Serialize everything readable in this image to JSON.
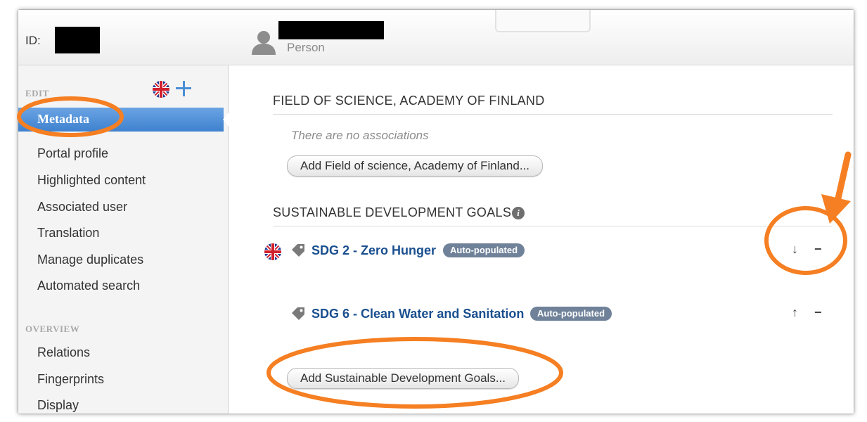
{
  "header": {
    "id_label": "ID:",
    "entity_type": "Person"
  },
  "sidebar": {
    "edit_heading": "EDIT",
    "edit_items": [
      {
        "label": "Metadata",
        "active": true
      },
      {
        "label": "Portal profile"
      },
      {
        "label": "Highlighted content"
      },
      {
        "label": "Associated user"
      },
      {
        "label": "Translation"
      },
      {
        "label": "Manage duplicates"
      },
      {
        "label": "Automated search"
      }
    ],
    "overview_heading": "OVERVIEW",
    "overview_items": [
      {
        "label": "Relations"
      },
      {
        "label": "Fingerprints"
      },
      {
        "label": "Display"
      }
    ]
  },
  "main": {
    "field_of_science": {
      "title": "FIELD OF SCIENCE, ACADEMY OF FINLAND",
      "empty_text": "There are no associations",
      "add_button": "Add Field of science, Academy of Finland..."
    },
    "sdg": {
      "title": "SUSTAINABLE DEVELOPMENT GOALS",
      "info_glyph": "i",
      "items": [
        {
          "label": "SDG 2 - Zero Hunger",
          "badge": "Auto-populated",
          "move": "↓",
          "remove": "−",
          "has_flag": true
        },
        {
          "label": "SDG 6 - Clean Water and Sanitation",
          "badge": "Auto-populated",
          "move": "↑",
          "remove": "−",
          "has_flag": false
        }
      ],
      "add_button": "Add Sustainable Development Goals..."
    }
  },
  "colors": {
    "active_nav": "#4a8ad4",
    "link": "#1a4f8f",
    "badge": "#6f8299",
    "annotation": "#f57f22"
  }
}
